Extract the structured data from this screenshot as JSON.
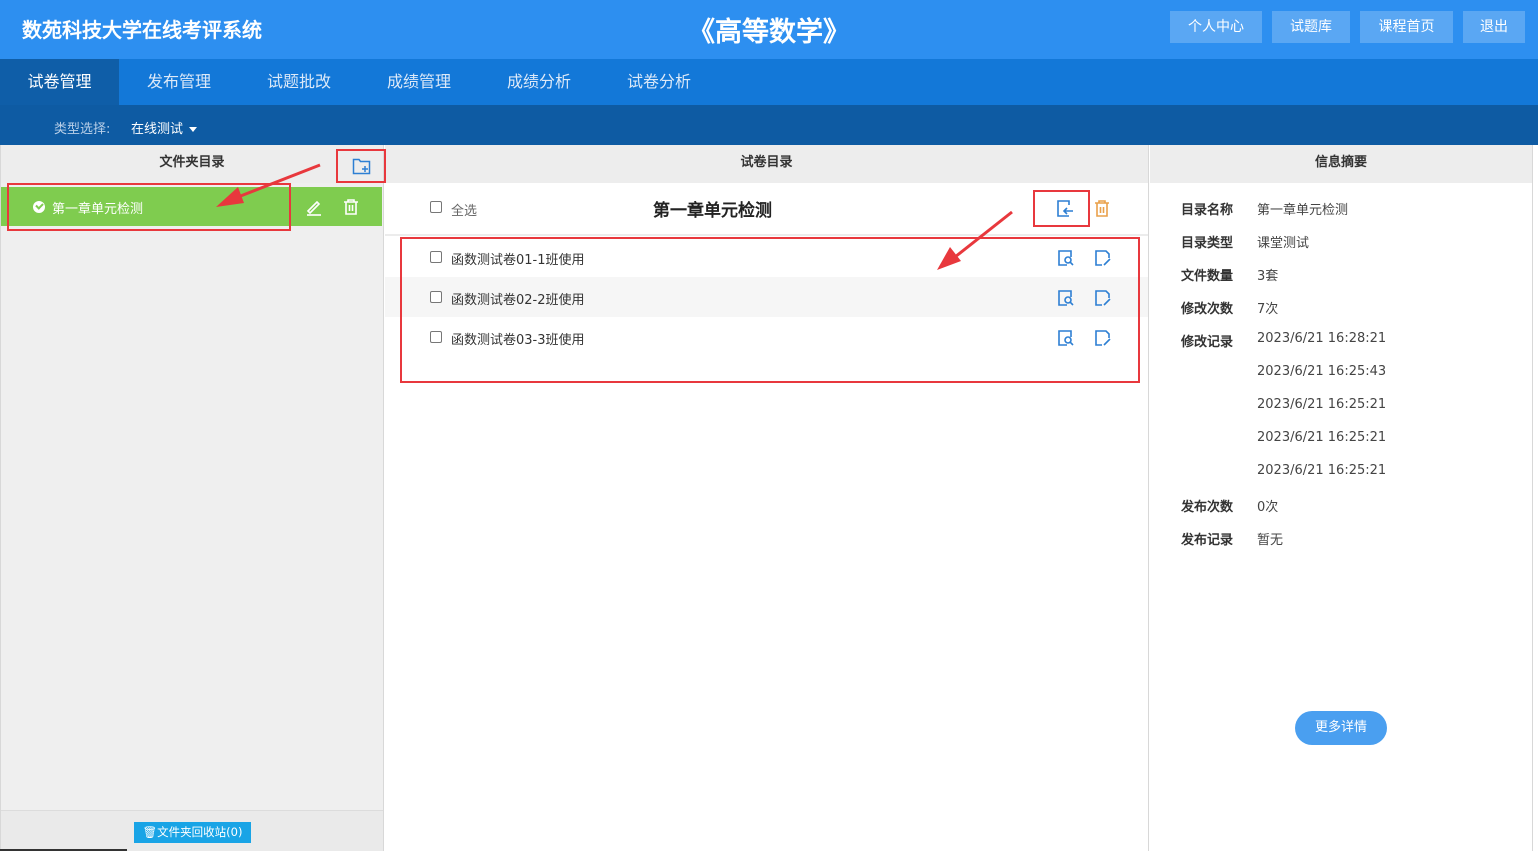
{
  "header": {
    "system_title": "数苑科技大学在线考评系统",
    "course_title": "《高等数学》",
    "buttons": [
      "个人中心",
      "试题库",
      "课程首页",
      "退出"
    ]
  },
  "nav": {
    "tabs": [
      "试卷管理",
      "发布管理",
      "试题批改",
      "成绩管理",
      "成绩分析",
      "试卷分析"
    ],
    "active_index": 0
  },
  "filter": {
    "label": "类型选择:",
    "value": "在线测试"
  },
  "left_panel": {
    "title": "文件夹目录",
    "folders": [
      {
        "name": "第一章单元检测",
        "selected": true
      }
    ],
    "recycle_label": "文件夹回收站(0)"
  },
  "mid_panel": {
    "title": "试卷目录",
    "select_all_label": "全选",
    "folder_title": "第一章单元检测",
    "papers": [
      {
        "name": "函数测试卷01-1班使用"
      },
      {
        "name": "函数测试卷02-2班使用"
      },
      {
        "name": "函数测试卷03-3班使用"
      }
    ]
  },
  "right_panel": {
    "title": "信息摘要",
    "fields": {
      "dir_name_label": "目录名称",
      "dir_name": "第一章单元检测",
      "dir_type_label": "目录类型",
      "dir_type": "课堂测试",
      "file_count_label": "文件数量",
      "file_count": "3套",
      "modify_count_label": "修改次数",
      "modify_count": "7次",
      "modify_log_label": "修改记录",
      "modify_log": [
        "2023/6/21 16:28:21",
        "2023/6/21 16:25:43",
        "2023/6/21 16:25:21",
        "2023/6/21 16:25:21",
        "2023/6/21 16:25:21"
      ],
      "publish_count_label": "发布次数",
      "publish_count": "0次",
      "publish_log_label": "发布记录",
      "publish_log": "暂无"
    },
    "more_label": "更多详情"
  },
  "colors": {
    "header_blue": "#2d8ff0",
    "nav_blue": "#1378d8",
    "filter_blue": "#0e5ba3",
    "folder_green": "#7fcc4f",
    "highlight_red": "#e8383d",
    "icon_blue": "#2d7fd3",
    "icon_orange": "#e9a04a"
  }
}
